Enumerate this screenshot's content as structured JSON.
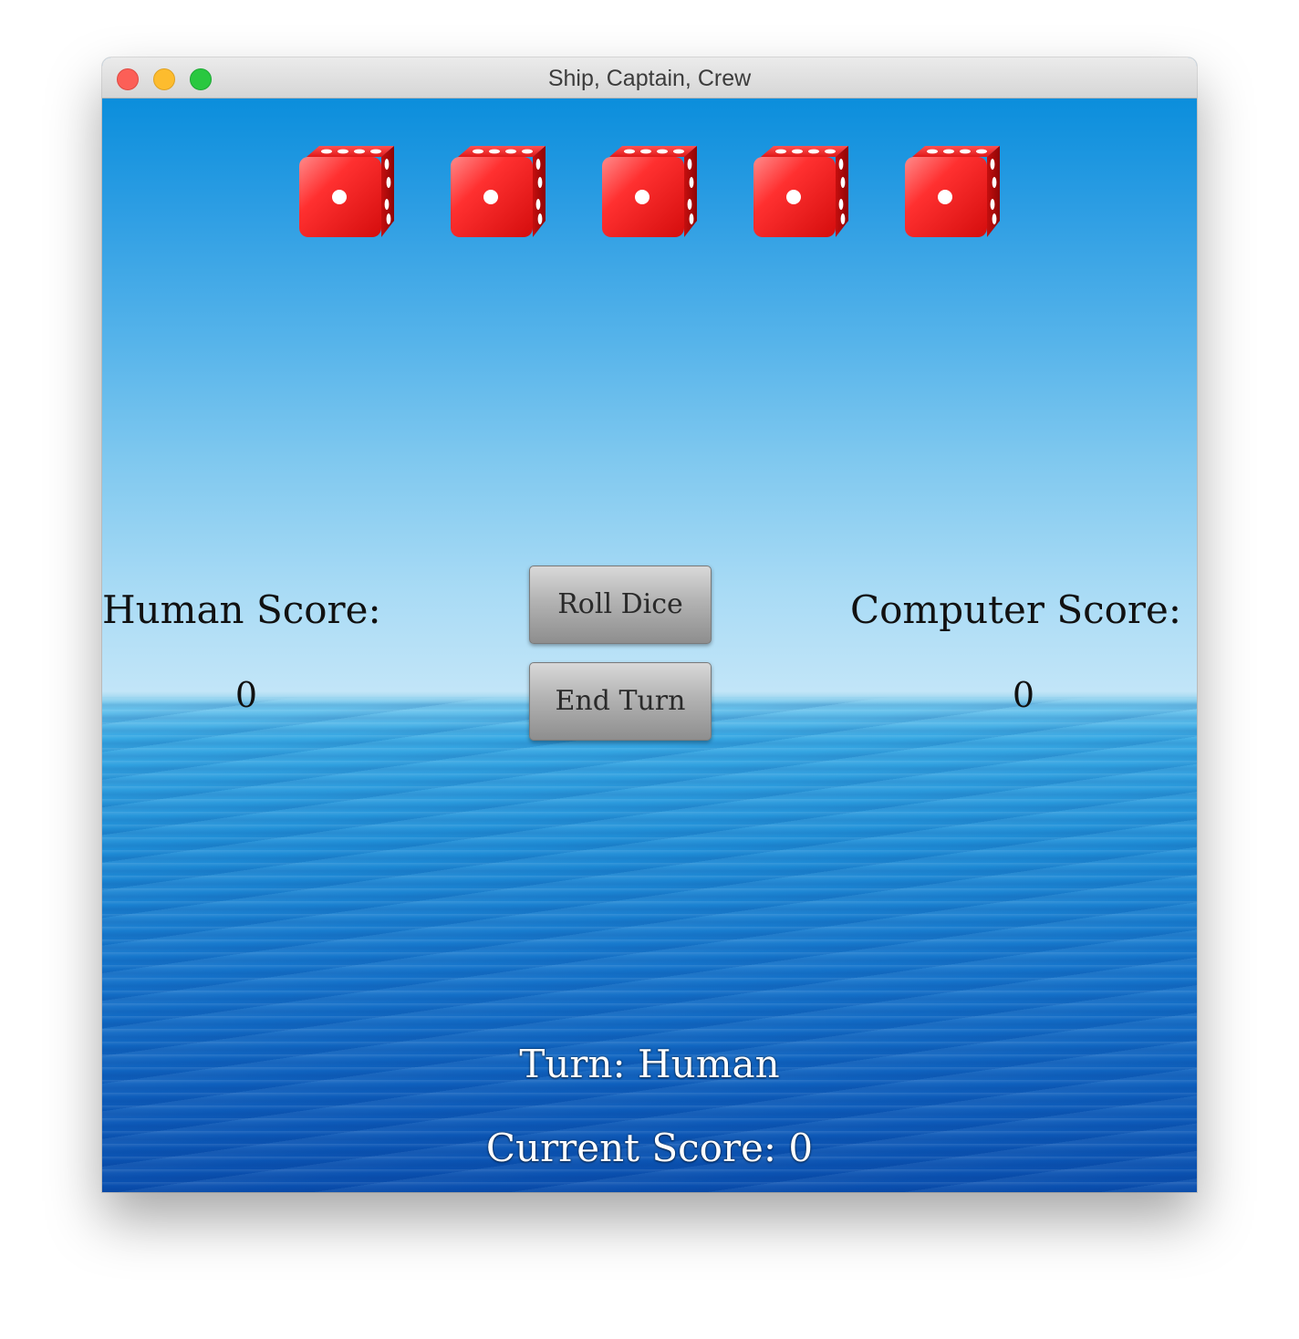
{
  "window": {
    "title": "Ship, Captain, Crew"
  },
  "dice": [
    {
      "face": 1,
      "color": "#e51b1b"
    },
    {
      "face": 1,
      "color": "#e51b1b"
    },
    {
      "face": 1,
      "color": "#e51b1b"
    },
    {
      "face": 1,
      "color": "#e51b1b"
    },
    {
      "face": 1,
      "color": "#e51b1b"
    }
  ],
  "scores": {
    "human_label": "Human Score:",
    "human_value": "0",
    "computer_label": "Computer Score:",
    "computer_value": "0"
  },
  "buttons": {
    "roll_label": "Roll Dice",
    "end_turn_label": "End Turn"
  },
  "status": {
    "turn_text": "Turn: Human",
    "current_score_text": "Current Score: 0"
  },
  "icons": {
    "die": "die-icon",
    "close": "close-window-icon",
    "minimize": "minimize-window-icon",
    "maximize": "maximize-window-icon"
  }
}
